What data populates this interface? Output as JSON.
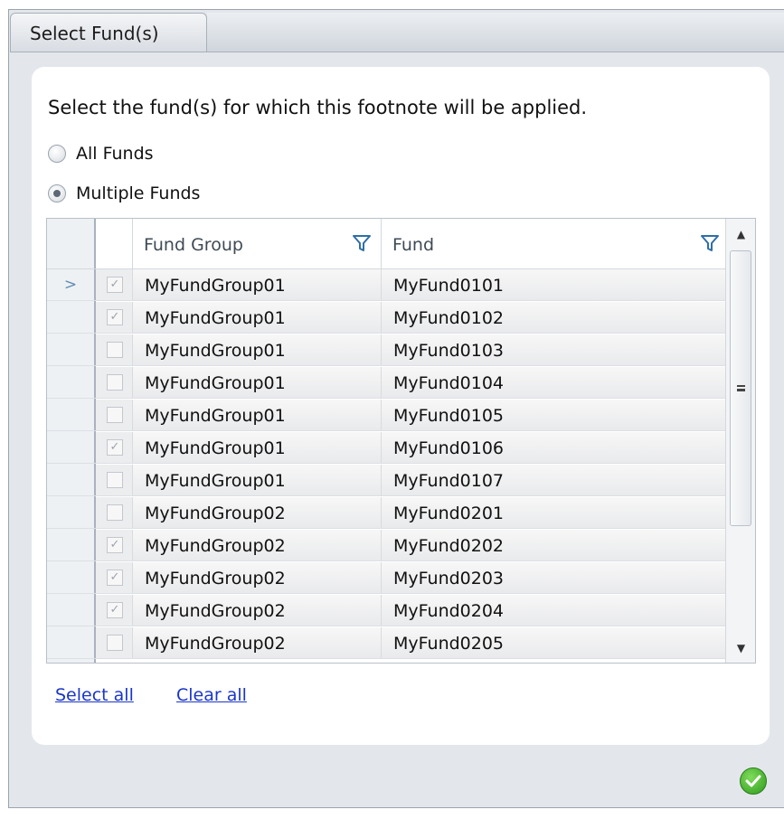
{
  "dialog": {
    "title": "Select Fund(s)",
    "instruction": "Select the fund(s) for which this footnote will be applied."
  },
  "options": {
    "all_funds_label": "All Funds",
    "multiple_funds_label": "Multiple Funds",
    "selected": "Multiple Funds"
  },
  "grid": {
    "columns": [
      "Fund Group",
      "Fund"
    ],
    "current_row_indicator": ">",
    "rows": [
      {
        "checked": true,
        "group": "MyFundGroup01",
        "fund": "MyFund0101"
      },
      {
        "checked": true,
        "group": "MyFundGroup01",
        "fund": "MyFund0102"
      },
      {
        "checked": false,
        "group": "MyFundGroup01",
        "fund": "MyFund0103"
      },
      {
        "checked": false,
        "group": "MyFundGroup01",
        "fund": "MyFund0104"
      },
      {
        "checked": false,
        "group": "MyFundGroup01",
        "fund": "MyFund0105"
      },
      {
        "checked": true,
        "group": "MyFundGroup01",
        "fund": "MyFund0106"
      },
      {
        "checked": false,
        "group": "MyFundGroup01",
        "fund": "MyFund0107"
      },
      {
        "checked": false,
        "group": "MyFundGroup02",
        "fund": "MyFund0201"
      },
      {
        "checked": true,
        "group": "MyFundGroup02",
        "fund": "MyFund0202"
      },
      {
        "checked": true,
        "group": "MyFundGroup02",
        "fund": "MyFund0203"
      },
      {
        "checked": true,
        "group": "MyFundGroup02",
        "fund": "MyFund0204"
      },
      {
        "checked": false,
        "group": "MyFundGroup02",
        "fund": "MyFund0205"
      }
    ]
  },
  "links": {
    "select_all": "Select all",
    "clear_all": "Clear all"
  },
  "icons": {
    "filter": "filter-funnel-icon",
    "ok": "green-checkmark-icon"
  },
  "colors": {
    "link": "#1a35c9",
    "filter_icon": "#2f6fa7",
    "ok_button": "#2f9a1d"
  }
}
